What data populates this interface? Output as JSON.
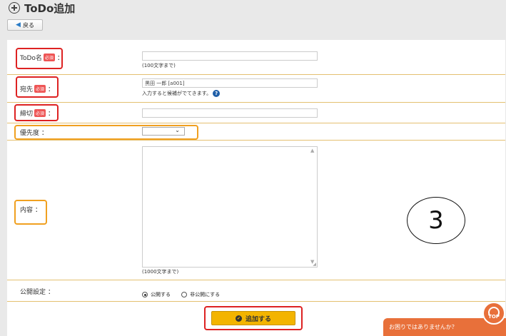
{
  "header": {
    "title": "ToDo追加",
    "back_label": "戻る"
  },
  "form": {
    "name": {
      "label": "ToDo名",
      "required": "必須",
      "colon": "：",
      "value": "",
      "note": "(100文字まで)"
    },
    "recipient": {
      "label": "宛先",
      "required": "必須",
      "colon": "：",
      "value": "黒田 一郎 [a001]",
      "note": "入力すると候補がでてきます。",
      "help": "?"
    },
    "deadline": {
      "label": "締切",
      "required": "必須",
      "colon": "：",
      "value": ""
    },
    "priority": {
      "label": "優先度",
      "colon": "：",
      "value": ""
    },
    "content": {
      "label": "内容",
      "colon": "：",
      "value": "",
      "note": "(1000文字まで)"
    },
    "visibility": {
      "label": "公開設定",
      "colon": "：",
      "options": [
        "公開する",
        "非公開にする"
      ],
      "selected": "公開する"
    }
  },
  "submit_label": "追加する",
  "annotation": "3",
  "help_bar": "お困りではありませんか？",
  "top_button": "TOP",
  "colors": {
    "accent": "#f3b400",
    "required": "#ee5555",
    "help": "#e8703a",
    "highlight_red": "#dd2222",
    "highlight_orange": "#f0a020"
  }
}
